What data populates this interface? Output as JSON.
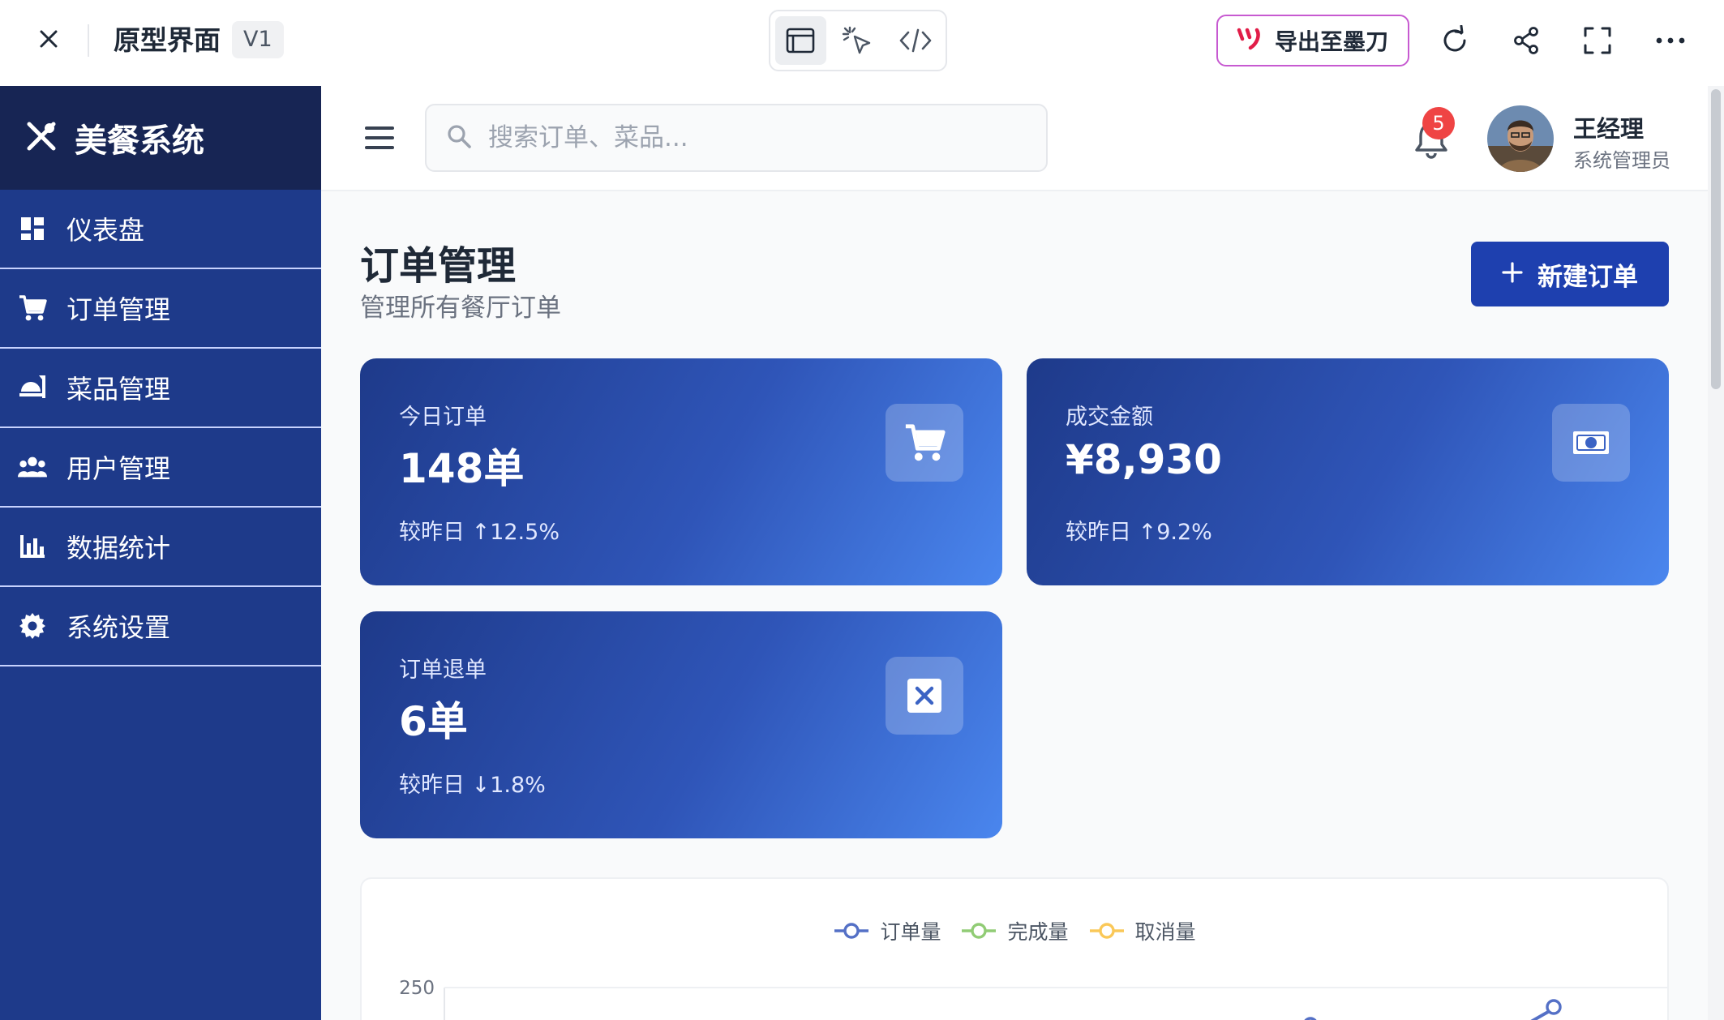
{
  "topbar": {
    "title": "原型界面",
    "version": "V1",
    "export_label": "导出至墨刀",
    "modes": [
      "preview-icon",
      "pointer-icon",
      "code-icon"
    ]
  },
  "sidebar": {
    "brand": "美餐系统",
    "items": [
      {
        "label": "仪表盘",
        "icon": "dashboard-icon"
      },
      {
        "label": "订单管理",
        "icon": "cart-icon"
      },
      {
        "label": "菜品管理",
        "icon": "dish-icon"
      },
      {
        "label": "用户管理",
        "icon": "users-icon"
      },
      {
        "label": "数据统计",
        "icon": "bar-chart-icon"
      },
      {
        "label": "系统设置",
        "icon": "gear-icon"
      }
    ]
  },
  "header": {
    "search_placeholder": "搜索订单、菜品...",
    "notification_count": "5",
    "user_name": "王经理",
    "user_role": "系统管理员"
  },
  "page": {
    "title": "订单管理",
    "subtitle": "管理所有餐厅订单",
    "new_button": "新建订单"
  },
  "stats": [
    {
      "label": "今日订单",
      "value": "148单",
      "delta": "较昨日 ↑12.5%",
      "icon": "cart-icon"
    },
    {
      "label": "成交金额",
      "value": "¥8,930",
      "delta": "较昨日 ↑9.2%",
      "icon": "money-icon"
    },
    {
      "label": "订单退单",
      "value": "6单",
      "delta": "较昨日 ↓1.8%",
      "icon": "cancel-icon"
    }
  ],
  "chart_data": {
    "type": "line",
    "title": "",
    "xlabel": "",
    "ylabel": "",
    "series": [
      {
        "name": "订单量",
        "color": "#5470c6"
      },
      {
        "name": "完成量",
        "color": "#91cc75"
      },
      {
        "name": "取消量",
        "color": "#fac858"
      }
    ],
    "y_ticks": [
      "250"
    ],
    "legend": "top-center"
  },
  "colors": {
    "primary": "#1e40af",
    "sidebar": "#1e3a8a",
    "badge": "#ef4444"
  }
}
